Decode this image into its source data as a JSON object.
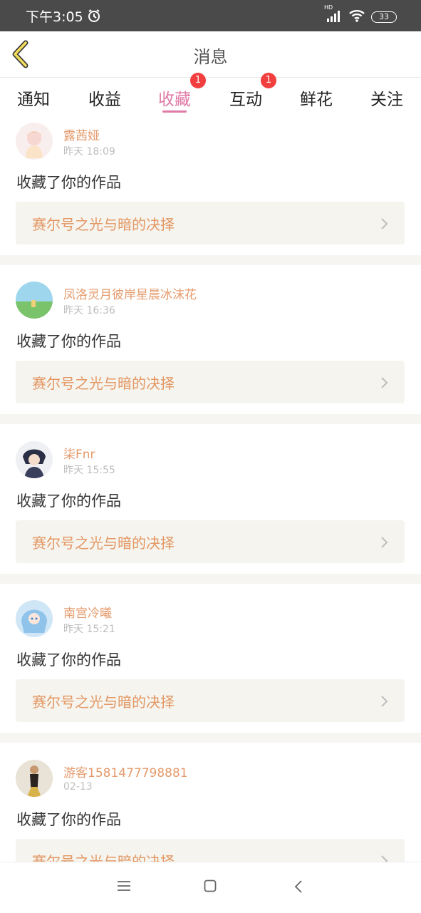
{
  "status_bar": {
    "time": "下午3:05",
    "battery": "33",
    "network": "HD"
  },
  "header": {
    "title": "消息",
    "back_icon": "chevron-left-icon"
  },
  "tabs": [
    {
      "label": "通知",
      "active": false
    },
    {
      "label": "收益",
      "active": false
    },
    {
      "label": "收藏",
      "active": true,
      "badge": "1"
    },
    {
      "label": "互动",
      "active": false,
      "badge": "1"
    },
    {
      "label": "鲜花",
      "active": false
    },
    {
      "label": "关注",
      "active": false
    }
  ],
  "items": [
    {
      "username": "露茜娅",
      "time": "昨天 18:09",
      "action": "收藏了你的作品",
      "work_title": "赛尔号之光与暗的决择"
    },
    {
      "username": "凤洛灵月彼岸星晨冰沫花",
      "time": "昨天 16:36",
      "action": "收藏了你的作品",
      "work_title": "赛尔号之光与暗的决择"
    },
    {
      "username": "柒Fnr",
      "time": "昨天 15:55",
      "action": "收藏了你的作品",
      "work_title": "赛尔号之光与暗的决择"
    },
    {
      "username": "南宫冷曦",
      "time": "昨天 15:21",
      "action": "收藏了你的作品",
      "work_title": "赛尔号之光与暗的决择"
    },
    {
      "username": "游客1581477798881",
      "time": "02-13",
      "action": "收藏了你的作品",
      "work_title": "赛尔号之光与暗的决择"
    }
  ],
  "colors": {
    "accent": "#e07aa6",
    "username": "#e59a6c",
    "link_text": "#e39764",
    "badge": "#f13e3e"
  }
}
